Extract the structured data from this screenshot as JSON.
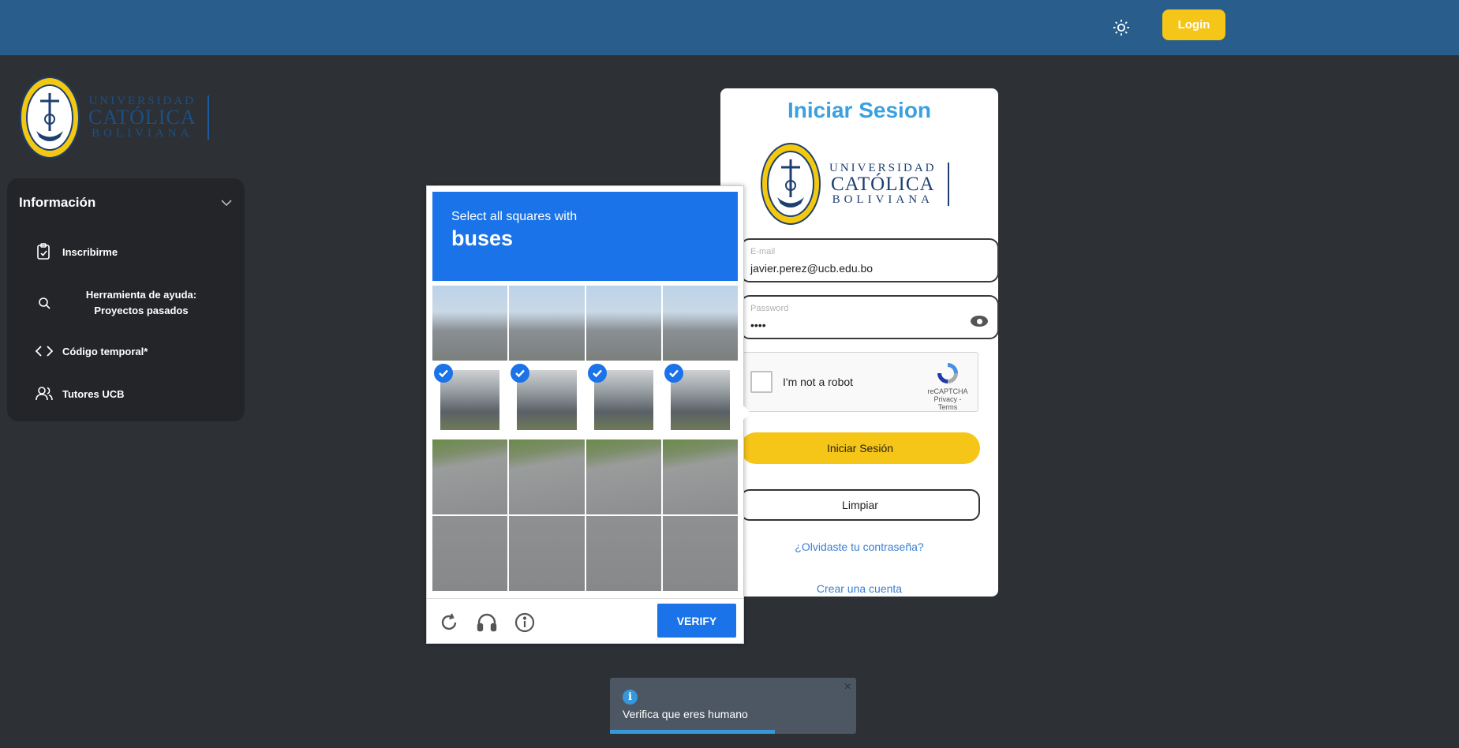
{
  "topbar": {
    "login_label": "Login"
  },
  "brand": {
    "line1": "UNIVERSIDAD",
    "line2": "CATÓLICA",
    "line3": "BOLIVIANA"
  },
  "sidebar": {
    "title": "Información",
    "items": [
      {
        "label": "Inscribirme",
        "icon": "clipboard-icon"
      },
      {
        "label": "Herramienta de ayuda:",
        "label2": "Proyectos pasados",
        "icon": "search-icon"
      },
      {
        "label": "Código temporal*",
        "icon": "code-icon"
      },
      {
        "label": "Tutores UCB",
        "icon": "users-icon"
      }
    ]
  },
  "login_card": {
    "title": "Iniciar Sesion",
    "email": {
      "label": "E-mail",
      "value": "javier.perez@ucb.edu.bo"
    },
    "password": {
      "label": "Password",
      "value": "••••"
    },
    "recaptcha": {
      "label": "I'm not a robot",
      "brand": "reCAPTCHA",
      "links": "Privacy - Terms"
    },
    "submit_label": "Iniciar Sesión",
    "clear_label": "Limpiar",
    "forgot_label": "¿Olvidaste tu contraseña?",
    "register_label": "Crear una cuenta"
  },
  "challenge": {
    "instruction": "Select all squares with",
    "target": "buses",
    "verify_label": "VERIFY",
    "selected_tiles": [
      4,
      5,
      6,
      7
    ]
  },
  "toast": {
    "message": "Verifica que eres humano",
    "progress": 0.67
  },
  "colors": {
    "topbar": "#295d8c",
    "accent_yellow": "#f5c518",
    "background": "#2d3136",
    "recaptcha_blue": "#1a73e8"
  }
}
